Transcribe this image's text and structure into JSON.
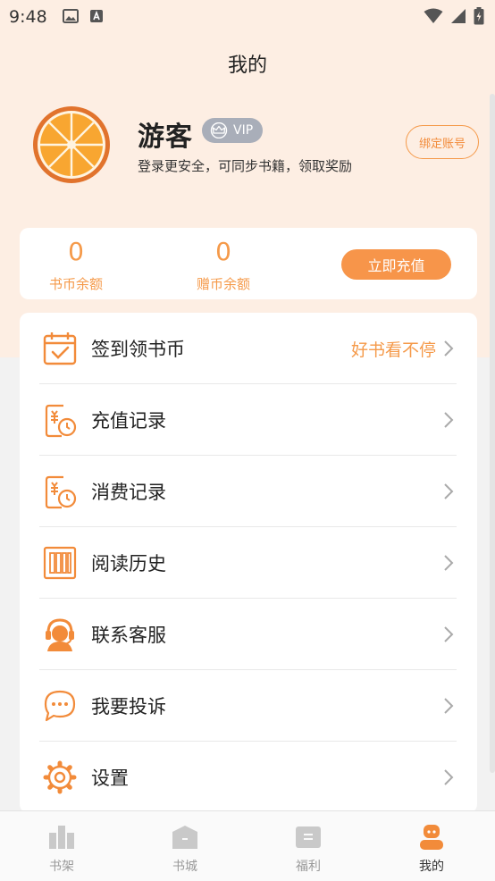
{
  "status_bar": {
    "time": "9:48"
  },
  "header": {
    "title": "我的"
  },
  "profile": {
    "name": "游客",
    "vip_label": "VIP",
    "subtitle": "登录更安全，可同步书籍，领取奖励",
    "bind_account_label": "绑定账号"
  },
  "balance": {
    "coin_value": "0",
    "coin_label": "书币余额",
    "gift_value": "0",
    "gift_label": "赠币余额",
    "recharge_label": "立即充值"
  },
  "menu": {
    "items": [
      {
        "label": "签到领书币",
        "extra": "好书看不停",
        "icon": "calendar-check-icon"
      },
      {
        "label": "充值记录",
        "icon": "recharge-record-icon"
      },
      {
        "label": "消费记录",
        "icon": "consume-record-icon"
      },
      {
        "label": "阅读历史",
        "icon": "reading-history-icon"
      },
      {
        "label": "联系客服",
        "icon": "customer-service-icon"
      },
      {
        "label": "我要投诉",
        "icon": "complaint-chat-icon"
      },
      {
        "label": "设置",
        "icon": "settings-gear-icon"
      }
    ]
  },
  "bottom_nav": {
    "items": [
      {
        "label": "书架",
        "icon": "bookshelf-icon"
      },
      {
        "label": "书城",
        "icon": "bookstore-icon"
      },
      {
        "label": "福利",
        "icon": "welfare-icon"
      },
      {
        "label": "我的",
        "icon": "profile-icon"
      }
    ],
    "active_index": 3
  },
  "colors": {
    "accent": "#f59a4a",
    "header_bg": "#fdeee3",
    "page_bg": "#f2f2f2",
    "nav_inactive": "#999999",
    "vip_badge": "#a9aeb9"
  }
}
